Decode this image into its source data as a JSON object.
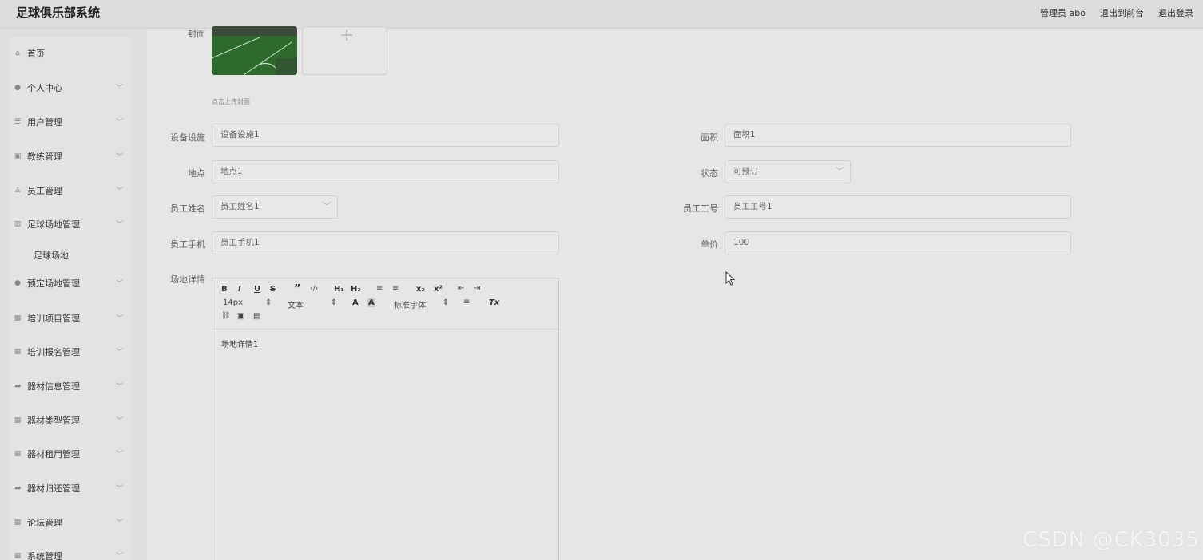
{
  "header": {
    "brand": "足球俱乐部系统",
    "user_label": "管理员 abo",
    "to_front": "退出到前台",
    "logout": "退出登录"
  },
  "sidebar": {
    "items": [
      {
        "label": "首页",
        "icon": "home-icon",
        "expandable": false
      },
      {
        "label": "个人中心",
        "icon": "user-icon",
        "expandable": true
      },
      {
        "label": "用户管理",
        "icon": "list-icon",
        "expandable": true
      },
      {
        "label": "教练管理",
        "icon": "briefcase-icon",
        "expandable": true
      },
      {
        "label": "员工管理",
        "icon": "person-icon",
        "expandable": true
      },
      {
        "label": "足球场地管理",
        "icon": "chart-icon",
        "expandable": true
      },
      {
        "label": "预定场地管理",
        "icon": "location-icon",
        "expandable": true
      },
      {
        "label": "培训项目管理",
        "icon": "grid-icon",
        "expandable": true
      },
      {
        "label": "培训报名管理",
        "icon": "grid-icon",
        "expandable": true
      },
      {
        "label": "器材信息管理",
        "icon": "message-icon",
        "expandable": true
      },
      {
        "label": "器材类型管理",
        "icon": "grid-icon",
        "expandable": true
      },
      {
        "label": "器材租用管理",
        "icon": "grid-icon",
        "expandable": true
      },
      {
        "label": "器材归还管理",
        "icon": "monitor-icon",
        "expandable": true
      },
      {
        "label": "论坛管理",
        "icon": "grid-icon",
        "expandable": true
      },
      {
        "label": "系统管理",
        "icon": "grid-icon",
        "expandable": true
      }
    ],
    "submenu": {
      "label": "足球场地"
    }
  },
  "form": {
    "cover_label": "封面",
    "upload_hint": "点击上传封面",
    "upload_plus": "+",
    "facility": {
      "label": "设备设施",
      "value": "设备设施1"
    },
    "area": {
      "label": "面积",
      "value": "面积1"
    },
    "location": {
      "label": "地点",
      "value": "地点1"
    },
    "status": {
      "label": "状态",
      "value": "可预订"
    },
    "staff_name": {
      "label": "员工姓名",
      "value": "员工姓名1"
    },
    "staff_no": {
      "label": "员工工号",
      "value": "员工工号1"
    },
    "staff_phone": {
      "label": "员工手机",
      "value": "员工手机1"
    },
    "price": {
      "label": "单价",
      "value": "100"
    },
    "detail": {
      "label": "场地详情",
      "content": "场地详情1"
    }
  },
  "editor_toolbar": {
    "bold": "B",
    "italic": "I",
    "underline": "U",
    "strike": "S",
    "quote": "”",
    "code": "‹/›",
    "h1": "H₁",
    "h2": "H₂",
    "ordered": "≡",
    "bullet": "≡",
    "sub": "x₂",
    "sup": "x²",
    "indent_out": "⇤",
    "indent_in": "⇥",
    "size": "14px",
    "header": "文本",
    "color": "A",
    "bg": "A",
    "font": "标准字体",
    "align": "≡",
    "clear": "Tx",
    "link": "🔗",
    "image": "▣",
    "video": "▤"
  },
  "watermark": "CSDN @CK3035"
}
